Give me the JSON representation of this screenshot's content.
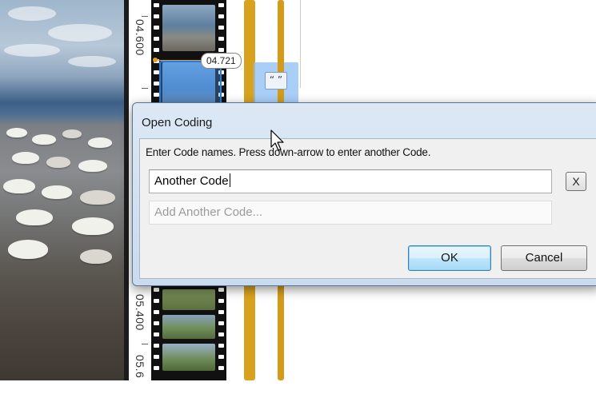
{
  "timeline": {
    "timecodes": [
      "04.600",
      "05.400",
      "05.6"
    ],
    "playhead_time": "04.721",
    "quote_marker": "“ ”"
  },
  "dialog": {
    "title": "Open Coding",
    "instructions": "Enter Code names. Press down-arrow to enter another Code.",
    "code_value": "Another Code",
    "add_placeholder": "Add Another Code...",
    "clear_label": "X",
    "ok_label": "OK",
    "cancel_label": "Cancel"
  },
  "colors": {
    "accent": "#3c7fb1",
    "waveform": "#d9a21e",
    "selection": "#2c7be0"
  },
  "icons": {
    "cursor": "arrow-cursor-icon",
    "quote": "quote-marker-icon"
  }
}
